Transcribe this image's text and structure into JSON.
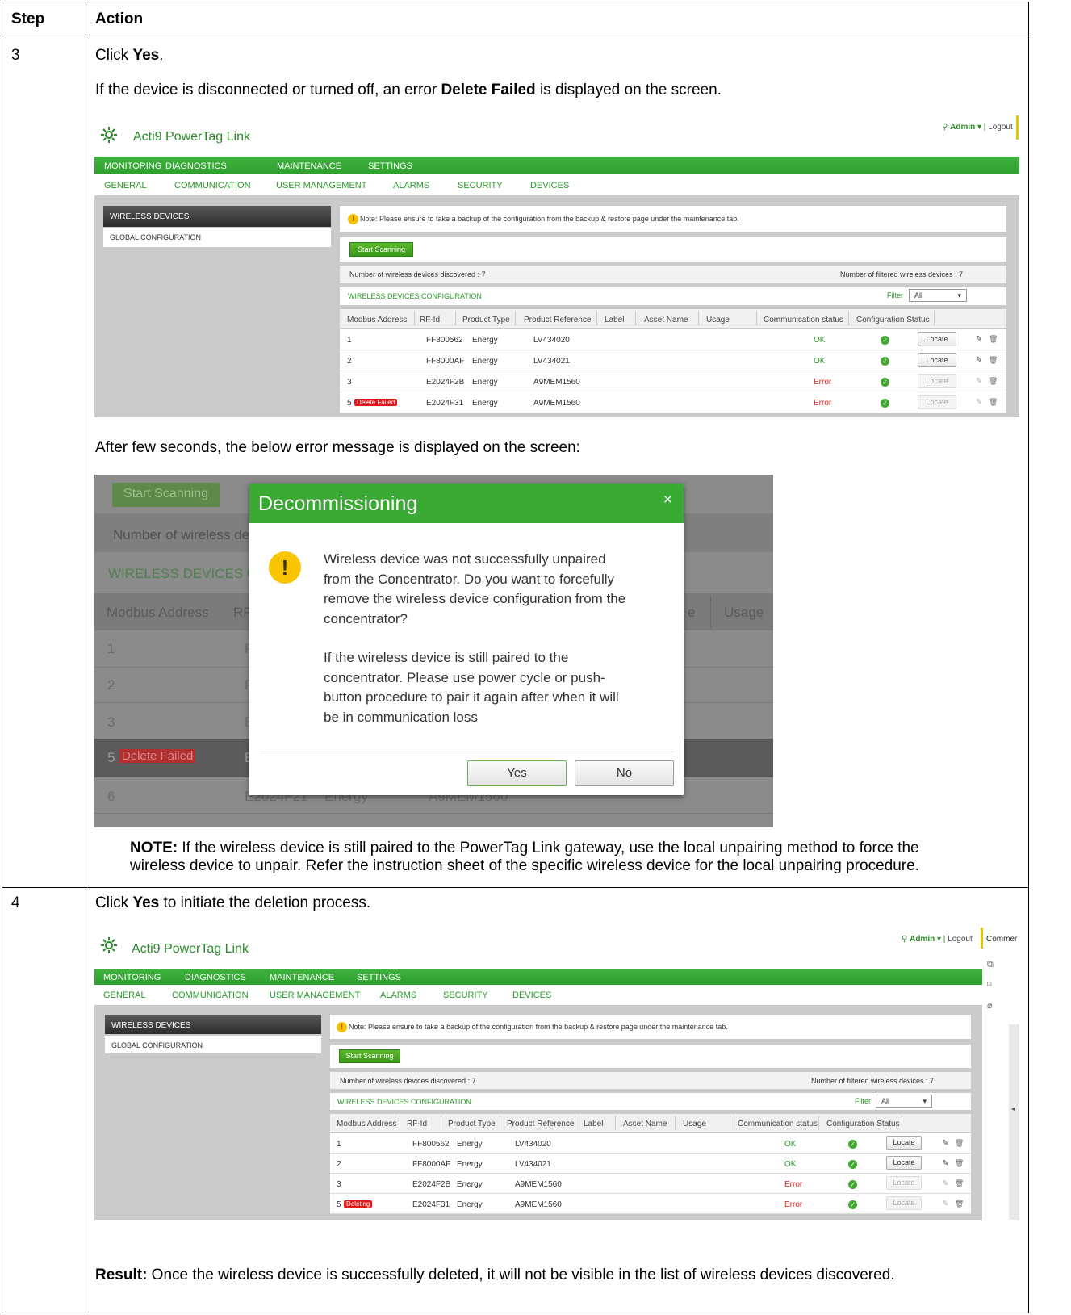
{
  "table": {
    "headers": {
      "step": "Step",
      "action": "Action"
    },
    "row3": {
      "step": "3",
      "line1_pre": "Click ",
      "line1_bold": "Yes",
      "line1_post": ".",
      "line2_pre": "If the device is disconnected or turned off, an error ",
      "line2_bold": "Delete Failed",
      "line2_post": " is displayed on the screen.",
      "after": "After few seconds, the below error message is displayed on the screen:",
      "note_bold": "NOTE:",
      "note_line1": " If the wireless device is still paired to the PowerTag Link gateway, use the local unpairing method to force the",
      "note_line2": "wireless device to unpair. Refer the instruction sheet of the specific wireless device for the local unpairing procedure."
    },
    "row4": {
      "step": "4",
      "line1_pre": "Click ",
      "line1_bold": "Yes",
      "line1_post": " to initiate the deletion process.",
      "result_bold": "Result:",
      "result_text": " Once the wireless device is successfully deleted, it will not be visible in the list of wireless devices discovered."
    }
  },
  "app": {
    "title": "Acti9 PowerTag Link",
    "admin": "Admin",
    "logout": "Logout",
    "side_comment": "Commer",
    "menu": [
      "MONITORING",
      "DIAGNOSTICS",
      "MAINTENANCE",
      "SETTINGS"
    ],
    "submenu": [
      "GENERAL",
      "COMMUNICATION",
      "USER MANAGEMENT",
      "ALARMS",
      "SECURITY",
      "DEVICES"
    ],
    "side": [
      "WIRELESS DEVICES",
      "GLOBAL CONFIGURATION"
    ],
    "note": "Note: Please ensure to take a backup of the configuration from the backup & restore page under the maintenance tab.",
    "start_scanning": "Start Scanning",
    "discovered": "Number of wireless devices discovered : 7",
    "filtered": "Number of filtered wireless devices : 7",
    "config_title": "WIRELESS DEVICES CONFIGURATION",
    "filter_label": "Filter",
    "filter_value": "All",
    "columns": [
      "Modbus Address",
      "RF-Id",
      "Product Type",
      "Product Reference",
      "Label",
      "Asset Name",
      "Usage",
      "Communication status",
      "Configuration Status"
    ],
    "locate": "Locate",
    "rows": [
      {
        "addr": "1",
        "tag": "",
        "rf": "FF800562",
        "type": "Energy",
        "ref": "LV434020",
        "comm": "OK",
        "status": "ok"
      },
      {
        "addr": "2",
        "tag": "",
        "rf": "FF8000AF",
        "type": "Energy",
        "ref": "LV434021",
        "comm": "OK",
        "status": "ok"
      },
      {
        "addr": "3",
        "tag": "",
        "rf": "E2024F2B",
        "type": "Energy",
        "ref": "A9MEM1560",
        "comm": "Error",
        "status": "err"
      },
      {
        "addr": "5",
        "tag": "Delete Failed",
        "rf": "E2024F31",
        "type": "Energy",
        "ref": "A9MEM1560",
        "comm": "Error",
        "status": "err"
      }
    ],
    "deleting_tag": "Deleting"
  },
  "dialog": {
    "title": "Decommissioning",
    "close": "×",
    "icon": "warning-icon",
    "p1": [
      "Wireless device was not successfully unpaired",
      "from the Concentrator. Do you want to forcefully",
      "remove the wireless device configuration from the",
      "concentrator?"
    ],
    "p2": [
      "If the wireless device is still paired to the",
      "concentrator. Please use power cycle or push-",
      "button procedure to pair it again after when it will",
      "be in communication loss"
    ],
    "yes": "Yes",
    "no": "No",
    "bg": {
      "start": "Start Scanning",
      "number": "Number of wireless de",
      "config": "WIRELESS DEVICES C",
      "modbus": "Modbus Address",
      "rf": "RF",
      "e": "e",
      "usage": "Usage",
      "r1": "1",
      "r2": "2",
      "r3": "3",
      "r5": "5",
      "delfail": "Delete Failed",
      "r6": "6",
      "rf6": "E2024F21",
      "type6": "Energy",
      "ref6": "A9MEM1560",
      "p1": "F",
      "p2": "F",
      "p3": "E",
      "p5": "E"
    }
  },
  "colors": {
    "green": "#3aaa35",
    "red": "#e01818",
    "yellow": "#f9c400"
  }
}
